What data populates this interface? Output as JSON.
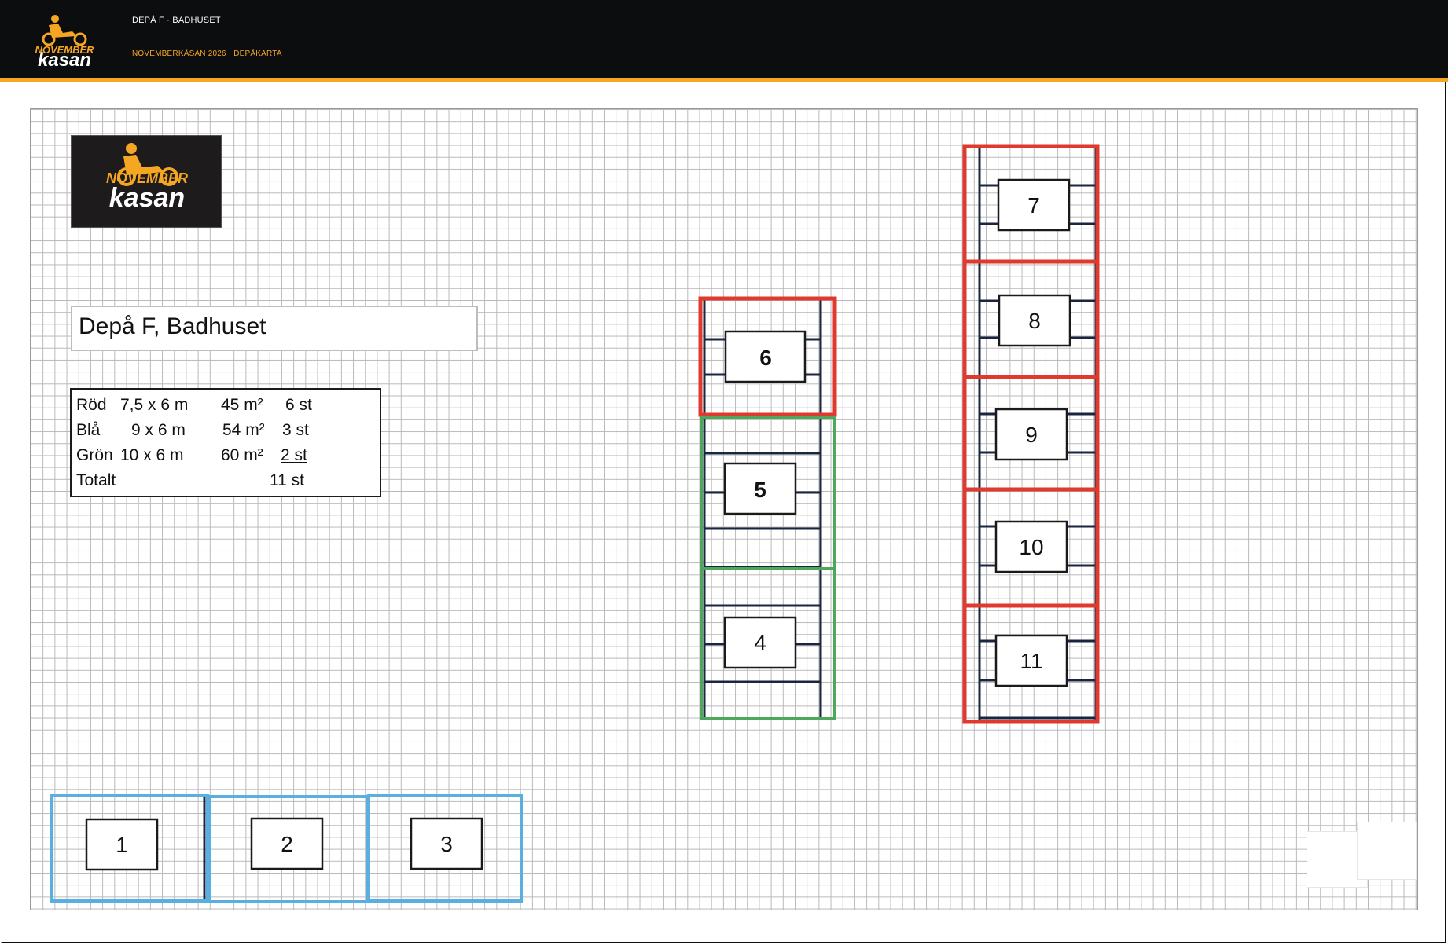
{
  "header": {
    "title": "DEPÅ F · BADHUSET",
    "subtitle": "NOVEMBERKÅSAN 2026 · DEPÅKARTA",
    "logo_top": "NOVEMBER",
    "logo_bottom": "kasan"
  },
  "map": {
    "title": "Depå F, Badhuset",
    "logo_top": "NOVEMBER",
    "logo_bottom": "kasan",
    "legend": [
      {
        "color": "Röd",
        "size": "7,5 x 6 m",
        "area": "45 m²",
        "count": "6 st"
      },
      {
        "color": "Blå",
        "size": "9 x 6 m",
        "area": "54 m²",
        "count": "3 st"
      },
      {
        "color": "Grön",
        "size": "10 x 6 m",
        "area": "60 m²",
        "count": "2 st"
      },
      {
        "color": "Totalt",
        "size": "",
        "area": "",
        "count": "11 st"
      }
    ],
    "slots": {
      "s1": "1",
      "s2": "2",
      "s3": "3",
      "s4": "4",
      "s5": "5",
      "s6": "6",
      "s7": "7",
      "s8": "8",
      "s9": "9",
      "s10": "10",
      "s11": "11"
    },
    "colors": {
      "red": "#e03a2e",
      "blue": "#5aaee0",
      "green": "#4ea85a",
      "navy": "#1a2540",
      "accent": "#f5a623"
    }
  }
}
